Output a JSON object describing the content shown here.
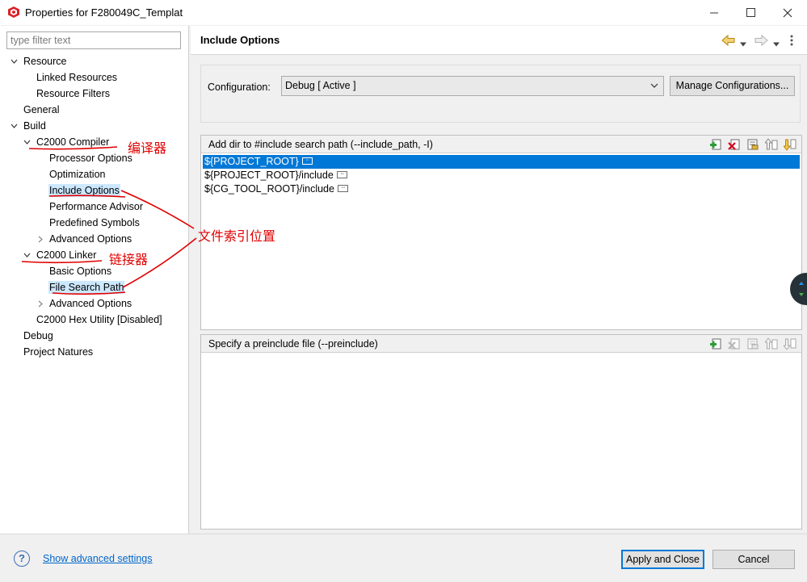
{
  "window": {
    "title": "Properties for F280049C_Templat"
  },
  "filter": {
    "placeholder": "type filter text"
  },
  "tree": {
    "items": [
      {
        "label": "Resource"
      },
      {
        "label": "Linked Resources"
      },
      {
        "label": "Resource Filters"
      },
      {
        "label": "General"
      },
      {
        "label": "Build"
      },
      {
        "label": "C2000 Compiler"
      },
      {
        "label": "Processor Options"
      },
      {
        "label": "Optimization"
      },
      {
        "label": "Include Options"
      },
      {
        "label": "Performance Advisor"
      },
      {
        "label": "Predefined Symbols"
      },
      {
        "label": "Advanced Options"
      },
      {
        "label": "C2000 Linker"
      },
      {
        "label": "Basic Options"
      },
      {
        "label": "File Search Path"
      },
      {
        "label": "Advanced Options"
      },
      {
        "label": "C2000 Hex Utility  [Disabled]"
      },
      {
        "label": "Debug"
      },
      {
        "label": "Project Natures"
      }
    ]
  },
  "annotations": {
    "compiler": "编译器",
    "include_location": "文件索引位置",
    "linker": "链接器"
  },
  "page": {
    "title": "Include Options"
  },
  "config": {
    "label": "Configuration:",
    "value": "Debug  [ Active ]",
    "manage_button": "Manage Configurations..."
  },
  "include_panel": {
    "title": "Add dir to #include search path (--include_path, -I)",
    "rows": [
      "${PROJECT_ROOT}",
      "${PROJECT_ROOT}/include",
      "${CG_TOOL_ROOT}/include"
    ]
  },
  "preinclude_panel": {
    "title": "Specify a preinclude file (--preinclude)"
  },
  "footer": {
    "help_icon": "?",
    "advanced_link": "Show advanced settings",
    "apply_button": "Apply and Close",
    "cancel_button": "Cancel"
  },
  "colors": {
    "selection": "#0078d7",
    "tree_selection": "#cce8ff",
    "annotation": "#e00000",
    "link": "#0066cc"
  }
}
